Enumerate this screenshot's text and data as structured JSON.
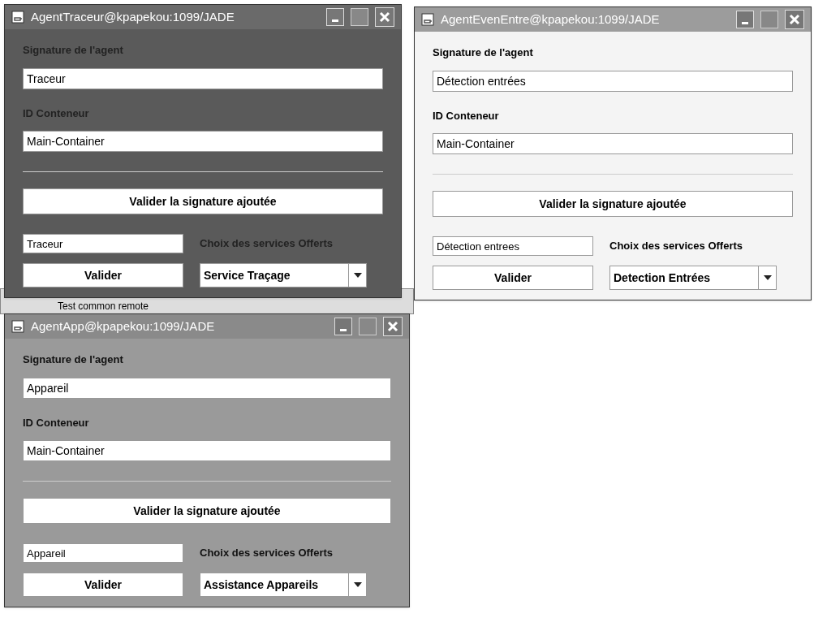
{
  "background_text": "Test common remote",
  "windows": [
    {
      "title": "AgentTraceur@kpapekou:1099/JADE",
      "color": "#5a5a5a",
      "signature_label": "Signature de l'agent",
      "signature_value": "Traceur",
      "container_label": "ID Conteneur",
      "container_value": "Main-Container",
      "validate_signature_button": "Valider la signature ajoutée",
      "service_field_value": "Traceur",
      "services_label": "Choix des services Offerts",
      "validate_button": "Valider",
      "service_combo_value": "Service Traçage"
    },
    {
      "title": "AgentEvenEntre@kpapekou:1099/JADE",
      "color": "#f4f4f4",
      "signature_label": "Signature de l'agent",
      "signature_value": "Détection entrées",
      "container_label": "ID Conteneur",
      "container_value": "Main-Container",
      "validate_signature_button": "Valider la signature ajoutée",
      "service_field_value": "Détection entrees",
      "services_label": "Choix des services Offerts",
      "validate_button": "Valider",
      "service_combo_value": "Detection Entrées"
    },
    {
      "title": "AgentApp@kpapekou:1099/JADE",
      "color": "#9a9a9a",
      "signature_label": "Signature de l'agent",
      "signature_value": "Appareil",
      "container_label": "ID Conteneur",
      "container_value": "Main-Container",
      "validate_signature_button": "Valider la signature ajoutée",
      "service_field_value": "Appareil",
      "services_label": "Choix des services Offerts",
      "validate_button": "Valider",
      "service_combo_value": "Assistance Appareils"
    }
  ]
}
